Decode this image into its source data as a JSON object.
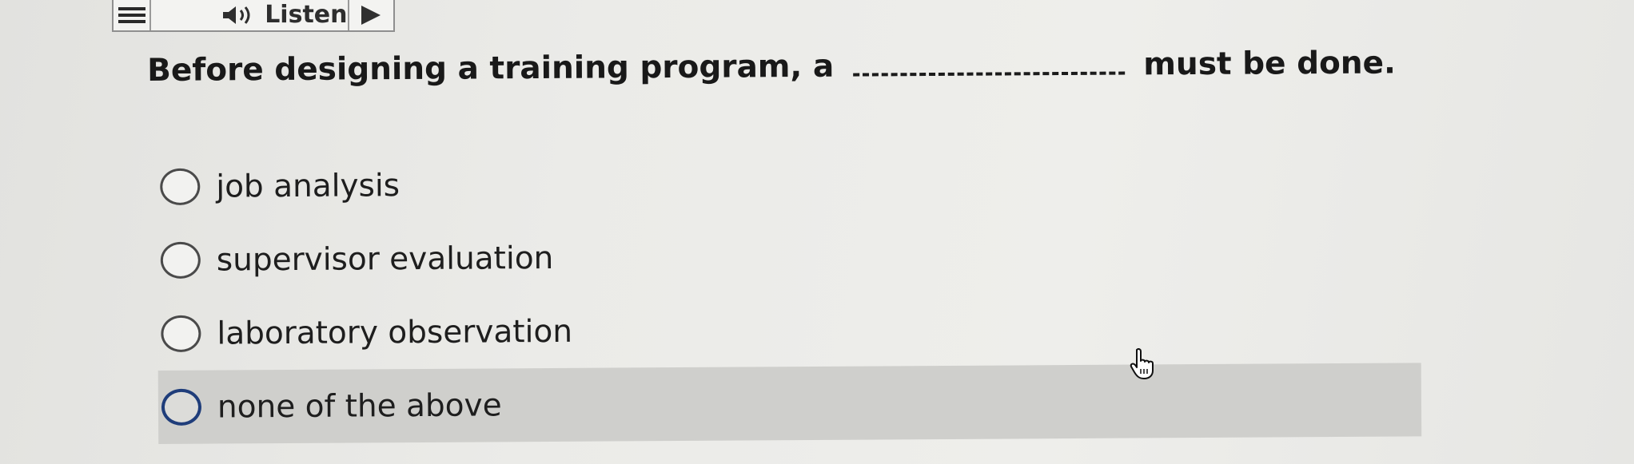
{
  "toolbar": {
    "menu_icon": "menu-icon",
    "speaker_icon": "speaker-icon",
    "listen_label": "Listen",
    "play_icon": "play-icon"
  },
  "question": {
    "before_blank": "Before designing a training program, a",
    "after_blank": "must be done."
  },
  "options": [
    {
      "label": "job analysis",
      "selected": false
    },
    {
      "label": "supervisor evaluation",
      "selected": false
    },
    {
      "label": "laboratory observation",
      "selected": false
    },
    {
      "label": "none of the above",
      "selected": false,
      "hovered": true
    }
  ],
  "cursor": {
    "icon": "hand-pointer-icon"
  },
  "colors": {
    "background": "#ebebe8",
    "hover_highlight": "#cfcfcc",
    "focus_ring": "#1f3d7a"
  }
}
